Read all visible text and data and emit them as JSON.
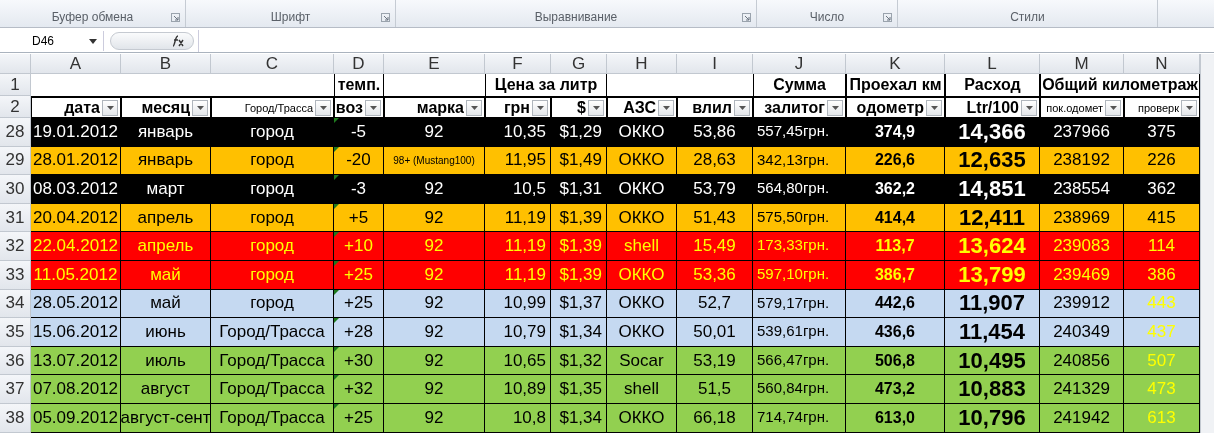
{
  "ribbon": {
    "groups": [
      {
        "label": "Буфер обмена",
        "launcher": true
      },
      {
        "label": "Шрифт",
        "launcher": true
      },
      {
        "label": "Выравнивание",
        "launcher": true
      },
      {
        "label": "Число",
        "launcher": true
      },
      {
        "label": "Стили",
        "launcher": false
      }
    ]
  },
  "formula_bar": {
    "name_box": "D46"
  },
  "header_row_numbers": [
    "1",
    "2"
  ],
  "columns": [
    {
      "letter": "A",
      "filter": "дата"
    },
    {
      "letter": "B",
      "filter": "месяц"
    },
    {
      "letter": "C",
      "filter": "Город/Трасса",
      "kind": "small"
    },
    {
      "letter": "D",
      "title": "темп.",
      "filter": "воз"
    },
    {
      "letter": "E",
      "filter": "марка"
    },
    {
      "letter": "F",
      "title": "Цена за литр",
      "merge_next": true,
      "filter": "грн"
    },
    {
      "letter": "G",
      "filter": "$"
    },
    {
      "letter": "H",
      "filter": "АЗС"
    },
    {
      "letter": "I",
      "filter": "влил"
    },
    {
      "letter": "J",
      "title": "Сумма",
      "filter": "залитог"
    },
    {
      "letter": "K",
      "title": "Проехал км",
      "filter": "одометр"
    },
    {
      "letter": "L",
      "title": "Расход",
      "filter": "Ltr/100"
    },
    {
      "letter": "M",
      "title": "Общий километраж",
      "merge_next": true,
      "filter": "пок.одомет",
      "kind": "small"
    },
    {
      "letter": "N",
      "filter": "проверк",
      "kind": "small"
    }
  ],
  "rows": [
    {
      "row_number": "28",
      "kind": "black",
      "cells": [
        "19.01.2012",
        "январь",
        "город",
        "-5",
        "92",
        "10,35",
        "$1,29",
        "ОККО",
        "53,86",
        "557,45грн.",
        "374,9",
        "14,366",
        "237966",
        "375"
      ]
    },
    {
      "row_number": "29",
      "kind": "orange",
      "cells": [
        "28.01.2012",
        "январь",
        "город",
        "-20",
        "98+ (Mustang100)",
        "11,95",
        "$1,49",
        "ОККО",
        "28,63",
        "342,13грн.",
        "226,6",
        "12,635",
        "238192",
        "226"
      ]
    },
    {
      "row_number": "30",
      "kind": "black",
      "cells": [
        "08.03.2012",
        "март",
        "город",
        "-3",
        "92",
        "10,5",
        "$1,31",
        "ОККО",
        "53,79",
        "564,80грн.",
        "362,2",
        "14,851",
        "238554",
        "362"
      ]
    },
    {
      "row_number": "31",
      "kind": "orange",
      "cells": [
        "20.04.2012",
        "апрель",
        "город",
        "+5",
        "92",
        "11,19",
        "$1,39",
        "ОККО",
        "51,43",
        "575,50грн.",
        "414,4",
        "12,411",
        "238969",
        "415"
      ]
    },
    {
      "row_number": "32",
      "kind": "red",
      "cells": [
        "22.04.2012",
        "апрель",
        "город",
        "+10",
        "92",
        "11,19",
        "$1,39",
        "shell",
        "15,49",
        "173,33грн.",
        "113,7",
        "13,624",
        "239083",
        "114"
      ]
    },
    {
      "row_number": "33",
      "kind": "red",
      "cells": [
        "11.05.2012",
        "май",
        "город",
        "+25",
        "92",
        "11,19",
        "$1,39",
        "ОККО",
        "53,36",
        "597,10грн.",
        "386,7",
        "13,799",
        "239469",
        "386"
      ]
    },
    {
      "row_number": "34",
      "kind": "blue",
      "cells": [
        "28.05.2012",
        "май",
        "город",
        "+25",
        "92",
        "10,99",
        "$1,37",
        "ОККО",
        "52,7",
        "579,17грн.",
        "442,6",
        "11,907",
        "239912",
        "443"
      ]
    },
    {
      "row_number": "35",
      "kind": "blue",
      "cells": [
        "15.06.2012",
        "июнь",
        "Город/Трасса",
        "+28",
        "92",
        "10,79",
        "$1,34",
        "ОККО",
        "50,01",
        "539,61грн.",
        "436,6",
        "11,454",
        "240349",
        "437"
      ]
    },
    {
      "row_number": "36",
      "kind": "green",
      "cells": [
        "13.07.2012",
        "июль",
        "Город/Трасса",
        "+30",
        "92",
        "10,65",
        "$1,32",
        "Socar",
        "53,19",
        "566,47грн.",
        "506,8",
        "10,495",
        "240856",
        "507"
      ]
    },
    {
      "row_number": "37",
      "kind": "green",
      "cells": [
        "07.08.2012",
        "август",
        "Город/Трасса",
        "+32",
        "92",
        "10,89",
        "$1,35",
        "shell",
        "51,5",
        "560,84грн.",
        "473,2",
        "10,883",
        "241329",
        "473"
      ]
    },
    {
      "row_number": "38",
      "kind": "green",
      "cells": [
        "05.09.2012",
        "август-сент",
        "Город/Трасса",
        "+25",
        "92",
        "10,8",
        "$1,34",
        "ОККО",
        "66,18",
        "714,74грн.",
        "613,0",
        "10,796",
        "241942",
        "613"
      ]
    }
  ]
}
